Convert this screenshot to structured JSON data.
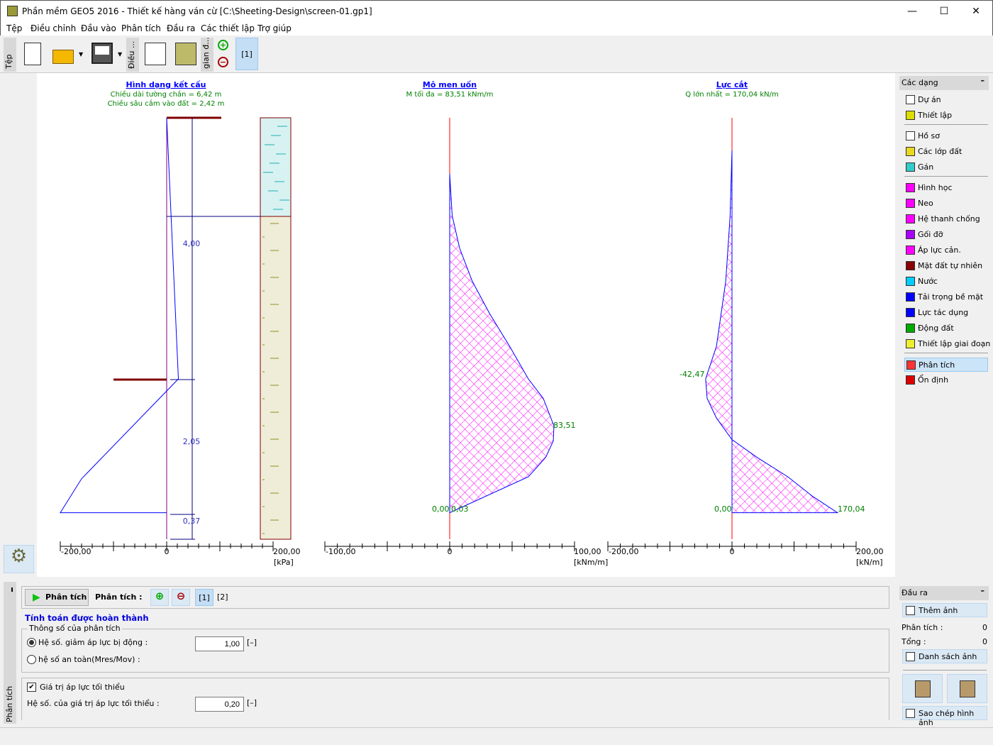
{
  "window": {
    "title": "Phần mềm GEO5 2016 - Thiết kế hàng ván cừ [C:\\Sheeting-Design\\screen-01.gp1]"
  },
  "menu": [
    "Tệp",
    "Điều chỉnh",
    "Đầu vào",
    "Phân tích",
    "Đầu ra",
    "Các thiết lập",
    "Trợ giúp"
  ],
  "toolbar": {
    "file_tab": "Tệp",
    "edit_tab": "Điều ...",
    "stage_tab": "gian đ...",
    "stage_label": "[1]"
  },
  "charts": {
    "structure": {
      "title": "Hình dạng kết cấu",
      "line1": "Chiều dài tường chắn = 6,42 m",
      "line2": "Chiều sâu cắm vào đất = 2,42 m",
      "dims": [
        "4,00",
        "2,05",
        "0,37"
      ],
      "axis_min": "-200,00",
      "axis_zero": "0",
      "axis_max": "200,00",
      "unit": "[kPa]"
    },
    "moment": {
      "title": "Mô men uốn",
      "subtitle": "M tối đa = 83,51 kNm/m",
      "max_label": "83,51",
      "end_label": "0,00",
      "end_label2": "0,03",
      "axis_min": "-100,00",
      "axis_zero": "0",
      "axis_max": "100,00",
      "unit": "[kNm/m]"
    },
    "shear": {
      "title": "Lực cắt",
      "subtitle": "Q lớn nhất = 170,04 kN/m",
      "min_label": "-42,47",
      "zero_label": "0,00",
      "max_label": "170,04",
      "axis_min": "-200,00",
      "axis_zero": "0",
      "axis_max": "200,00",
      "unit": "[kN/m]"
    }
  },
  "chart_data": [
    {
      "type": "line",
      "name": "pressure",
      "xlabel": "[kPa]",
      "xlim": [
        -200,
        200
      ],
      "depth_unit": "m",
      "points": [
        [
          0,
          0
        ],
        [
          22,
          4.0
        ],
        [
          -160,
          5.53
        ],
        [
          -200,
          6.05
        ],
        [
          0,
          6.05
        ]
      ]
    },
    {
      "type": "area",
      "title": "Mô men uốn",
      "xlabel": "[kNm/m]",
      "xlim": [
        -100,
        100
      ],
      "points": [
        [
          0,
          0.86
        ],
        [
          2,
          1.5
        ],
        [
          8,
          2.0
        ],
        [
          18,
          2.5
        ],
        [
          32,
          3.0
        ],
        [
          48,
          3.5
        ],
        [
          63,
          4.0
        ],
        [
          75,
          4.3
        ],
        [
          83.51,
          4.72
        ],
        [
          83,
          4.95
        ],
        [
          77,
          5.2
        ],
        [
          63,
          5.5
        ],
        [
          0.03,
          6.05
        ]
      ]
    },
    {
      "type": "area",
      "title": "Lực cắt",
      "xlabel": "[kN/m]",
      "xlim": [
        -200,
        200
      ],
      "points": [
        [
          0,
          0.5
        ],
        [
          -3,
          1.5
        ],
        [
          -10,
          2.5
        ],
        [
          -25,
          3.5
        ],
        [
          -42.47,
          4.0
        ],
        [
          -40,
          4.3
        ],
        [
          -25,
          4.6
        ],
        [
          0,
          4.93
        ],
        [
          40,
          5.2
        ],
        [
          90,
          5.5
        ],
        [
          130,
          5.8
        ],
        [
          170.04,
          6.05
        ]
      ]
    }
  ],
  "soil": {
    "water_color": "#d8f2f2",
    "soil_color": "#efedd8"
  },
  "colors": {
    "hatch": "#ff00ff",
    "curve": "#0000ff",
    "axis_zero": "#ff0000",
    "labels": "#008000",
    "title": "#0000ff"
  },
  "right_panel": {
    "header": "Các dạng",
    "collapse": "–",
    "items": [
      {
        "label": "Dự án",
        "icon": "document-icon"
      },
      {
        "label": "Thiết lập",
        "icon": "gear-icon"
      },
      {
        "label": "Hồ sơ",
        "icon": "profile-icon"
      },
      {
        "label": "Các lớp đất",
        "icon": "soil-icon"
      },
      {
        "label": "Gán",
        "icon": "assign-icon"
      },
      {
        "label": "Hình học",
        "icon": "geometry-icon"
      },
      {
        "label": "Neo",
        "icon": "anchor-icon"
      },
      {
        "label": "Hệ thanh chống",
        "icon": "strut-icon"
      },
      {
        "label": "Gối đỡ",
        "icon": "support-icon"
      },
      {
        "label": "Áp lực cản.",
        "icon": "pressure-icon"
      },
      {
        "label": "Mặt đất tự nhiên",
        "icon": "terrain-icon"
      },
      {
        "label": "Nước",
        "icon": "water-icon"
      },
      {
        "label": "Tải trọng bề mặt",
        "icon": "surcharge-icon"
      },
      {
        "label": "Lực tác dụng",
        "icon": "force-icon"
      },
      {
        "label": "Động đất",
        "icon": "earthquake-icon"
      },
      {
        "label": "Thiết lập giai đoạn",
        "icon": "stage-icon"
      },
      {
        "label": "Phân tích",
        "icon": "analysis-icon"
      },
      {
        "label": "Ổn định",
        "icon": "stability-icon"
      }
    ]
  },
  "output_panel": {
    "header": "Đầu ra",
    "add_picture": "Thêm ảnh",
    "analysis_label": "Phân tích :",
    "analysis_count": "0",
    "total_label": "Tổng :",
    "total_count": "0",
    "list_pictures": "Danh sách ảnh",
    "copy_view": "Sao chép  hình ảnh"
  },
  "bottom": {
    "side_tab": "Phân tích",
    "run_button": "Phân tích",
    "analysis_label": "Phân tích :",
    "analyses": [
      "[1]",
      "[2]"
    ],
    "status": "Tính toán được hoàn thành",
    "group_title": "Thông số của phân tích",
    "radio1": "Hệ số. giảm áp lực bị động :",
    "radio1_value": "1,00",
    "unit": "[–]",
    "radio2": "hệ số an toàn(Mres/Mov) :",
    "checkbox": "Giá trị áp lực tối thiểu",
    "min_label": "Hệ số. của giá trị áp lực tối thiểu :",
    "min_value": "0,20"
  }
}
